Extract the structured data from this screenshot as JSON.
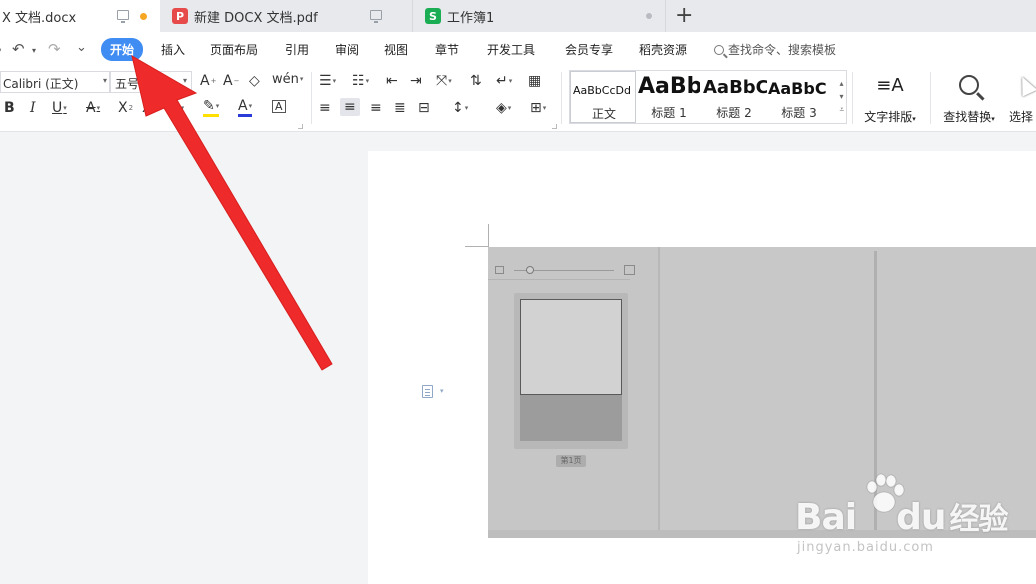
{
  "tabs": [
    {
      "title": "X 文档.docx",
      "state": "active",
      "badge": "",
      "dot_color": "#f5a623"
    },
    {
      "title": "新建 DOCX 文档.pdf",
      "state": "inactive",
      "badge": "P",
      "badge_color": "#e64a4a"
    },
    {
      "title": "工作簿1",
      "state": "inactive",
      "badge": "S",
      "badge_color": "#1aad54"
    }
  ],
  "new_tab_symbol": "+",
  "quick_access": {
    "undo": "↶",
    "redo": "↷",
    "customize": "⌄"
  },
  "menu": [
    "开始",
    "插入",
    "页面布局",
    "引用",
    "审阅",
    "视图",
    "章节",
    "开发工具",
    "会员专享",
    "稻壳资源"
  ],
  "menu_active": "开始",
  "menu_search_text": "查找命令、搜索模板",
  "ribbon": {
    "font_name": "Calibri (正文)",
    "font_size": "五号",
    "styles": [
      {
        "preview": "AaBbCcDd",
        "name": "正文"
      },
      {
        "preview": "AaBb",
        "name": "标题 1"
      },
      {
        "preview": "AaBbC",
        "name": "标题 2"
      },
      {
        "preview": "AaBbC",
        "name": "标题 3"
      }
    ],
    "text_layout_label": "文字排版",
    "find_replace_label": "查找替换",
    "select_label": "选择"
  },
  "embedded_screenshot": {
    "page_label": "第1页"
  },
  "watermark": {
    "brand": "Bai",
    "brand_tail": "du",
    "brand_cn": "经验",
    "url": "jingyan.baidu.com"
  },
  "colors": {
    "accent": "#3f8cf3",
    "arrow": "#ee2a2a",
    "highlight_yellow": "#ffe000",
    "font_color_blue": "#2b3bd8"
  }
}
